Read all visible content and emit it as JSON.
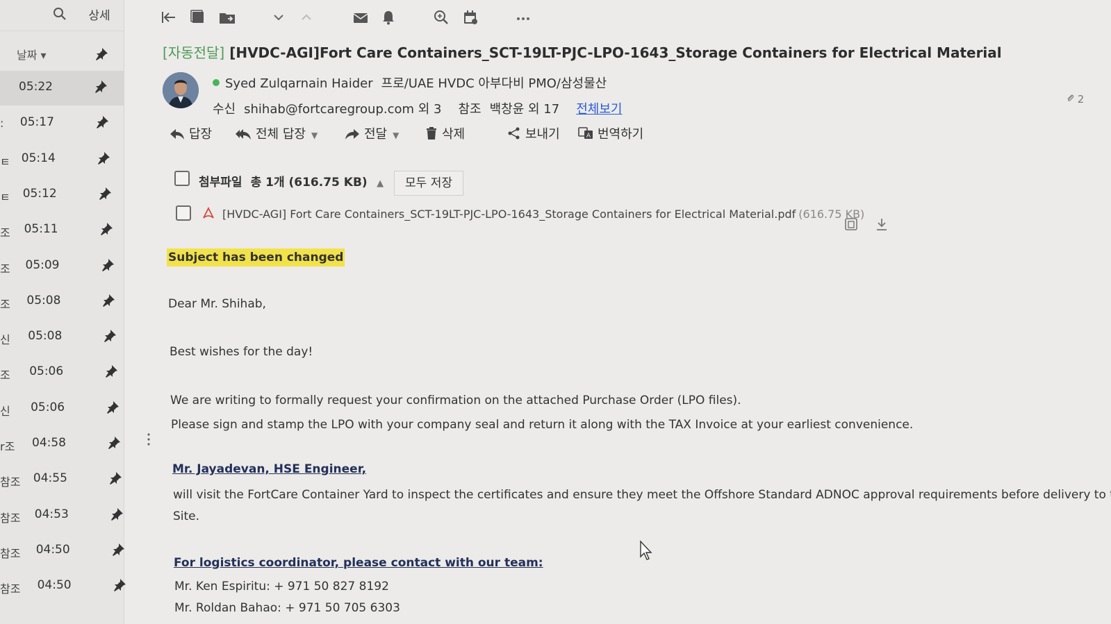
{
  "left_pane": {
    "detail_label": "상세",
    "sort_label": "날짜 ▾",
    "items": [
      {
        "prefix": "",
        "time": "05:22",
        "selected": true
      },
      {
        "prefix": ":",
        "time": "05:17"
      },
      {
        "prefix": "ㅌ",
        "time": "05:14"
      },
      {
        "prefix": "ㅌ",
        "time": "05:12"
      },
      {
        "prefix": "조",
        "time": "05:11"
      },
      {
        "prefix": "조",
        "time": "05:09"
      },
      {
        "prefix": "조",
        "time": "05:08"
      },
      {
        "prefix": "신",
        "time": "05:08"
      },
      {
        "prefix": "조",
        "time": "05:06"
      },
      {
        "prefix": "신",
        "time": "05:06"
      },
      {
        "prefix": "r조",
        "time": "04:58"
      },
      {
        "prefix": "참조",
        "time": "04:55"
      },
      {
        "prefix": "참조",
        "time": "04:53"
      },
      {
        "prefix": "참조",
        "time": "04:50"
      },
      {
        "prefix": "참조",
        "time": "04:50"
      }
    ]
  },
  "email": {
    "subject_prefix": "[자동전달]",
    "subject": "[HVDC-AGI]Fort Care Containers_SCT-19LT-PJC-LPO-1643_Storage Containers for Electrical Material",
    "sender_name": "Syed Zulqarnain Haider",
    "sender_title": "프로/UAE HVDC 아부다비 PMO/삼성물산",
    "to_label": "수신",
    "to_value": "shihab@fortcaregroup.com 외 3",
    "cc_label": "참조",
    "cc_value": "백창윤 외 17",
    "view_all": "전체보기",
    "right_edge_tag": "2",
    "actions": {
      "reply": "답장",
      "reply_all": "전체 답장",
      "forward": "전달",
      "delete": "삭제",
      "send": "보내기",
      "translate": "번역하기"
    },
    "attachments": {
      "label": "첨부파일",
      "summary": "총 1개 (616.75 KB)",
      "save_all": "모두 저장",
      "file_name": "[HVDC-AGI] Fort Care Containers_SCT-19LT-PJC-LPO-1643_Storage Containers for Electrical Material.pdf",
      "file_size": "(616.75 KB)"
    },
    "body": {
      "notice": "Subject has been changed",
      "greeting": "Dear Mr. Shihab,",
      "wishes": "Best wishes for the day!",
      "line1": "We are writing to formally request your confirmation on the attached Purchase Order (LPO files).",
      "line2": "Please sign and stamp the LPO with your company seal and return it along with the TAX Invoice at your earliest convenience.",
      "engineer_heading": "Mr. Jayadevan, HSE Engineer,",
      "engineer_text": "will visit the FortCare Container Yard to inspect the certificates and ensure they meet the Offshore Standard ADNOC approval requirements before delivery to th",
      "engineer_text2": "Site.",
      "logistics_heading": "For logistics coordinator, please contact with our team:",
      "contact1": "Mr. Ken Espiritu: + 971 50 827 8192",
      "contact2": "Mr. Roldan Bahao: + 971 50 705 6303"
    }
  }
}
